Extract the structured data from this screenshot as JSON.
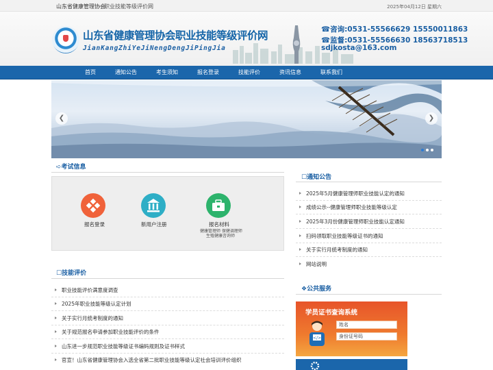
{
  "topbar": {
    "site_link": "山东省健康管理协会",
    "sub_link": "职业技能等级评价网",
    "date": "2025年04月12日 星期六"
  },
  "header": {
    "title": "山东省健康管理协会职业技能等级评价网",
    "pinyin": "JianKangZhiYeJiNengDengJiPingJia",
    "consult": "☎咨询:0531-55566629 15550011863",
    "supervise": "☎监督:0531-55566630 18563718513",
    "email": "sdjkosta@163.com"
  },
  "nav": {
    "items": [
      "首页",
      "通知公告",
      "考生须知",
      "报名登录",
      "技能评价",
      "资讯信息",
      "联系我们"
    ]
  },
  "banner": {
    "prev_icon": "chevron-left-icon",
    "next_icon": "chevron-right-icon",
    "slide_count": 3,
    "active_slide": 1
  },
  "exam_info": {
    "title": "➪考试信息",
    "cards": [
      {
        "label": "报名登录",
        "icon": "diamond-grid-icon",
        "color": "#f0623a"
      },
      {
        "label": "新用户注册",
        "icon": "bank-building-icon",
        "color": "#2eaec6"
      },
      {
        "label": "报名材料",
        "icon": "toolbox-icon",
        "color": "#2db36c",
        "sub": [
          "健康管理师 保健调理师",
          "生殖健康咨询师"
        ]
      }
    ]
  },
  "skills": {
    "title": "☐技能评价",
    "items": [
      "职业技能评价满意度调查",
      "2025年职业技能等级认定计划",
      "关于实行月统考制度的通知",
      "关于规范报名申请参加职业技能评价的条件",
      "山东进一步规范职业技能等级证书编码规则及证书样式",
      "官宣！山东省健康管理协会入选全省第二批职业技能等级认定社会培训评价组织"
    ]
  },
  "notices": {
    "title": "☐通知公告",
    "items": [
      "2025年5月健康管理师职业技能认定的通知",
      "成绩公示--健康管理师职业技能等级认定",
      "2025年3月份健康管理师职业技能认定通知",
      "扫码领取职业技能等级证书的通知",
      "关于实行月统考制度的通知",
      "网站说明"
    ]
  },
  "public_service": {
    "title": "❖公共服务",
    "cert_title": "学员证书查询系统",
    "name_placeholder": "姓名",
    "id_placeholder": "身份证号码"
  },
  "colors": {
    "brand_blue": "#1b66ab",
    "title_blue": "#1565a8",
    "cert_orange": "#e7542a"
  }
}
